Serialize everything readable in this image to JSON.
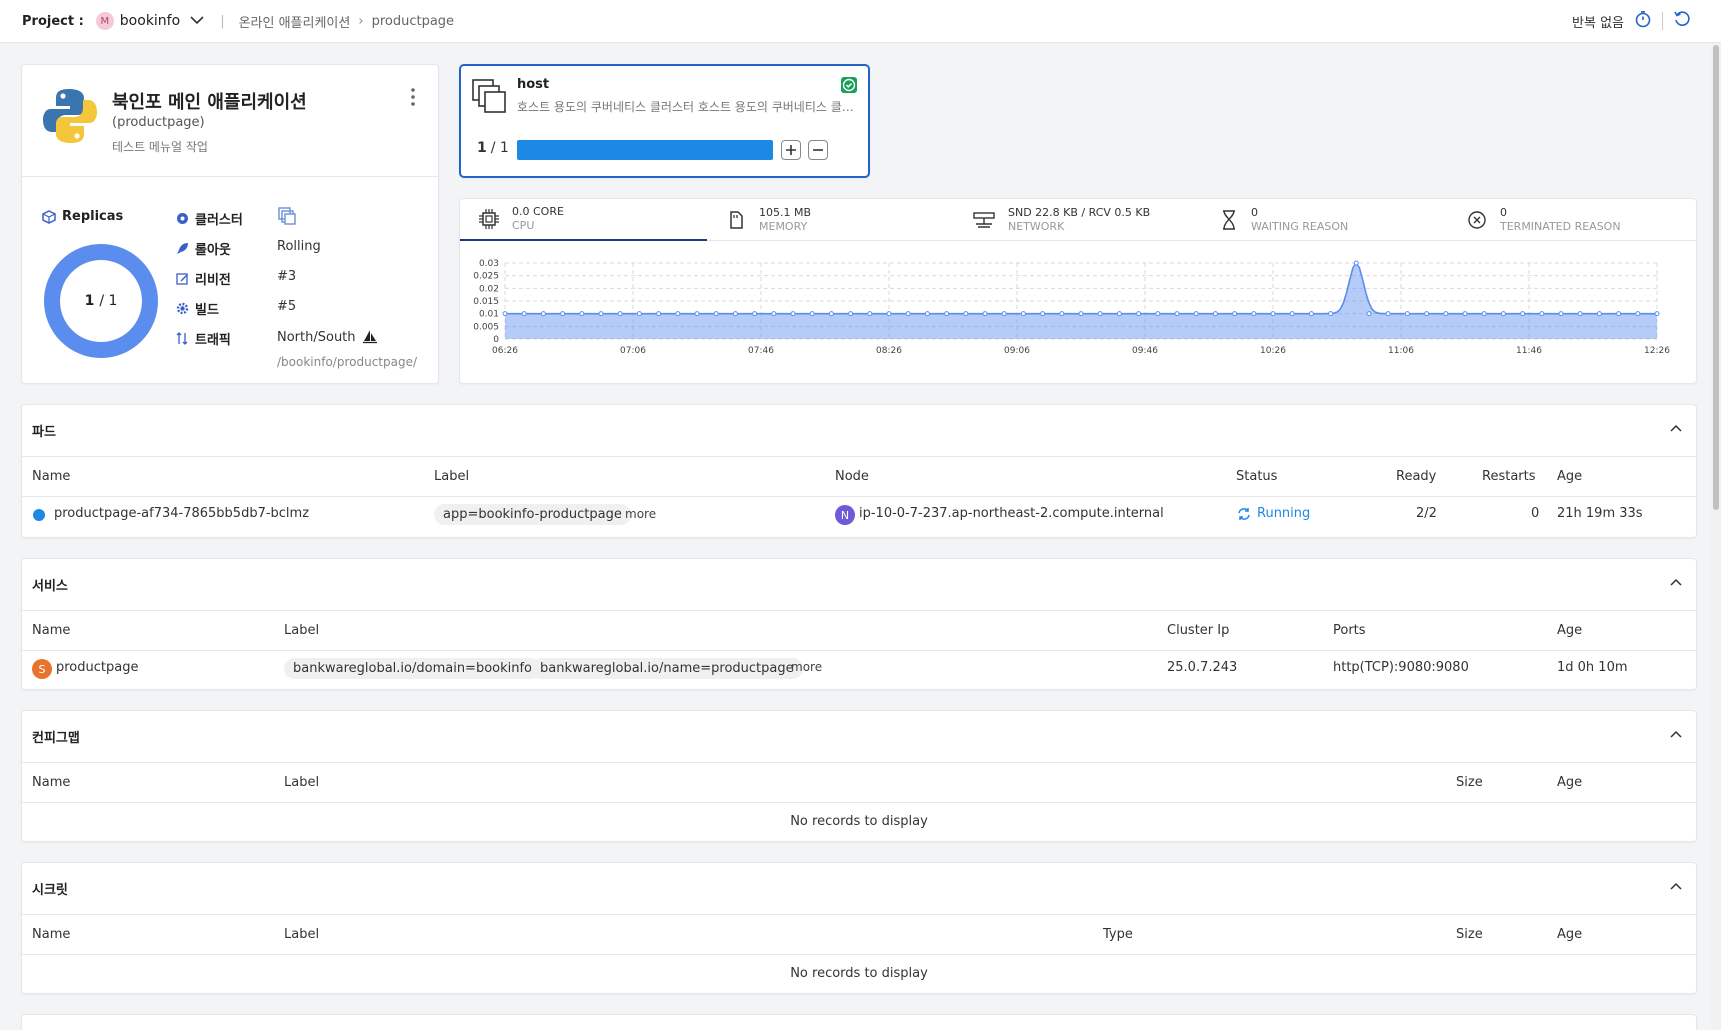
{
  "topbar": {
    "project_label": "Project :",
    "project_icon_letter": "M",
    "project_name": "bookinfo",
    "breadcrumb": [
      "온라인 애플리케이션",
      "productpage"
    ],
    "repeat_label": "반복 없음"
  },
  "app": {
    "title": "북인포 메인 애플리케이션",
    "subtitle": "(productpage)",
    "description": "테스트 메뉴얼 작업",
    "replicas_label": "Replicas",
    "replicas_current": "1",
    "replicas_total": "/ 1",
    "replicas_fraction": 1.0,
    "fields": [
      {
        "label": "클러스터",
        "value": ""
      },
      {
        "label": "롤아웃",
        "value": "Rolling"
      },
      {
        "label": "리비전",
        "value": "#3"
      },
      {
        "label": "빌드",
        "value": "#5"
      },
      {
        "label": "트래픽",
        "value": "North/South"
      }
    ],
    "traffic_path": "/bookinfo/productpage/"
  },
  "host": {
    "name": "host",
    "description": "호스트 용도의 쿠버네티스 클러스터 호스트 용도의 쿠버네티스 클러스터",
    "count_current": "1",
    "count_total": "/ 1",
    "fill_fraction": 1.0
  },
  "metrics": {
    "tabs": [
      {
        "value": "0.0 CORE",
        "label": "CPU",
        "icon": "cpu-icon"
      },
      {
        "value": "105.1 MB",
        "label": "MEMORY",
        "icon": "memory-icon"
      },
      {
        "value": "SND 22.8 KB / RCV 0.5 KB",
        "label": "NETWORK",
        "icon": "network-icon"
      },
      {
        "value": "0",
        "label": "WAITING REASON",
        "icon": "hourglass-icon"
      },
      {
        "value": "0",
        "label": "TERMINATED REASON",
        "icon": "x-circle-icon"
      }
    ]
  },
  "chart_data": {
    "type": "area",
    "x": [
      "06:26",
      "06:32",
      "06:38",
      "06:44",
      "06:50",
      "06:56",
      "07:02",
      "07:08",
      "07:14",
      "07:20",
      "07:26",
      "07:32",
      "07:38",
      "07:44",
      "07:50",
      "07:56",
      "08:02",
      "08:08",
      "08:14",
      "08:20",
      "08:26",
      "08:32",
      "08:38",
      "08:44",
      "08:50",
      "08:56",
      "09:02",
      "09:08",
      "09:14",
      "09:20",
      "09:26",
      "09:32",
      "09:38",
      "09:44",
      "09:50",
      "09:56",
      "10:02",
      "10:08",
      "10:14",
      "10:20",
      "10:26",
      "10:32",
      "10:38",
      "10:44",
      "10:50",
      "10:56",
      "11:02",
      "11:08",
      "11:14",
      "11:20",
      "11:26",
      "11:32",
      "11:38",
      "11:44",
      "11:50",
      "11:56",
      "12:02",
      "12:08",
      "12:14",
      "12:20",
      "12:26"
    ],
    "values": [
      0.01,
      0.01,
      0.01,
      0.01,
      0.01,
      0.01,
      0.01,
      0.01,
      0.01,
      0.01,
      0.01,
      0.01,
      0.01,
      0.01,
      0.01,
      0.01,
      0.01,
      0.01,
      0.01,
      0.01,
      0.01,
      0.01,
      0.01,
      0.01,
      0.01,
      0.01,
      0.01,
      0.01,
      0.01,
      0.01,
      0.01,
      0.01,
      0.01,
      0.01,
      0.01,
      0.01,
      0.01,
      0.01,
      0.01,
      0.01,
      0.01,
      0.01,
      0.01,
      0.01,
      0.01,
      0.01,
      0.01,
      0.01,
      0.01,
      0.01,
      0.01,
      0.01,
      0.01,
      0.01,
      0.01,
      0.01,
      0.01,
      0.01,
      0.01,
      0.01,
      0.01
    ],
    "peak": {
      "x": "10:52",
      "y": 0.03
    },
    "xticks": [
      "06:26",
      "07:06",
      "07:46",
      "08:26",
      "09:06",
      "09:46",
      "10:26",
      "11:06",
      "11:46",
      "12:26"
    ],
    "yticks": [
      "0",
      "0.005",
      "0.01",
      "0.015",
      "0.02",
      "0.025",
      "0.03"
    ],
    "ylim": [
      0,
      0.03
    ],
    "color": "#5b8def"
  },
  "pods": {
    "title": "파드",
    "columns": [
      "Name",
      "Label",
      "Node",
      "Status",
      "Ready",
      "Restarts",
      "Age"
    ],
    "rows": [
      {
        "name": "productpage-af734-7865bb5db7-bclmz",
        "label": "app=bookinfo-productpage",
        "more": "more",
        "node_badge": "N",
        "node": "ip-10-0-7-237.ap-northeast-2.compute.internal",
        "status": "Running",
        "ready": "2/2",
        "restarts": "0",
        "age": "21h 19m 33s"
      }
    ]
  },
  "services": {
    "title": "서비스",
    "columns": [
      "Name",
      "Label",
      "Cluster Ip",
      "Ports",
      "Age"
    ],
    "rows": [
      {
        "badge": "S",
        "name": "productpage",
        "labels": [
          "bankwareglobal.io/domain=bookinfo",
          "bankwareglobal.io/name=productpage"
        ],
        "more": "more",
        "cluster_ip": "25.0.7.243",
        "ports": "http(TCP):9080:9080",
        "age": "1d 0h 10m"
      }
    ]
  },
  "configmaps": {
    "title": "컨피그맵",
    "columns": [
      "Name",
      "Label",
      "Size",
      "Age"
    ],
    "empty": "No records to display"
  },
  "secrets": {
    "title": "시크릿",
    "columns": [
      "Name",
      "Label",
      "Type",
      "Size",
      "Age"
    ],
    "empty": "No records to display"
  },
  "colors": {
    "primary": "#1e88e5",
    "host_border": "#2563c9",
    "donut": "#5b8def",
    "node_badge": "#6d5cd6",
    "service_badge": "#e8732c",
    "check": "#18a058"
  }
}
